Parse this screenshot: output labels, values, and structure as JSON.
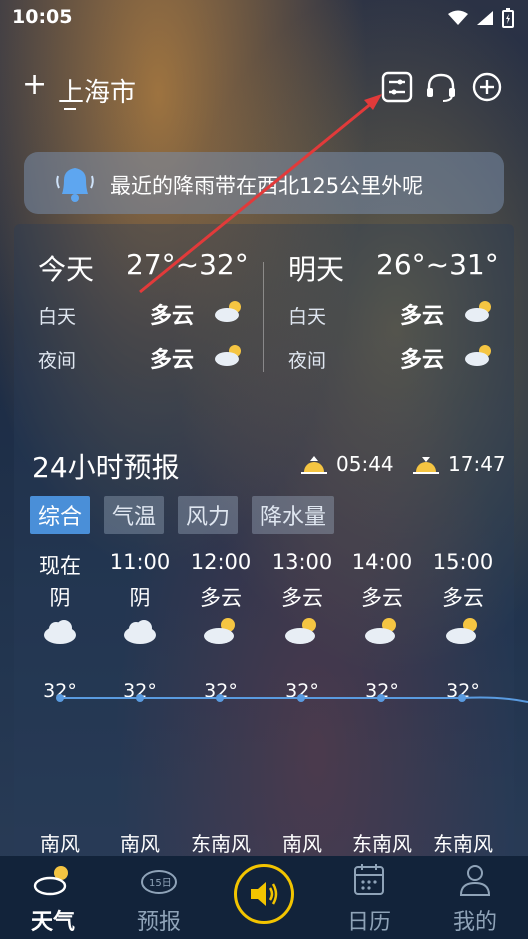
{
  "status": {
    "time": "10:05"
  },
  "header": {
    "add_label": "+",
    "city": "上海市"
  },
  "alert": {
    "text": "最近的降雨带在西北125公里外呢"
  },
  "days": [
    {
      "name": "今天",
      "range": "27°~32°",
      "day_label": "白天",
      "day_cond": "多云",
      "night_label": "夜间",
      "night_cond": "多云"
    },
    {
      "name": "明天",
      "range": "26°~31°",
      "day_label": "白天",
      "day_cond": "多云",
      "night_label": "夜间",
      "night_cond": "多云"
    }
  ],
  "forecast": {
    "title": "24小时预报",
    "sunrise": "05:44",
    "sunset": "17:47",
    "tabs": [
      "综合",
      "气温",
      "风力",
      "降水量"
    ],
    "hours": [
      {
        "time": "现在",
        "cond": "阴",
        "icon": "cloudy-icon",
        "temp": "32°",
        "wind": "南风"
      },
      {
        "time": "11:00",
        "cond": "阴",
        "icon": "cloudy-icon",
        "temp": "32°",
        "wind": "南风"
      },
      {
        "time": "12:00",
        "cond": "多云",
        "icon": "partly-cloudy-icon",
        "temp": "32°",
        "wind": "东南风"
      },
      {
        "time": "13:00",
        "cond": "多云",
        "icon": "partly-cloudy-icon",
        "temp": "32°",
        "wind": "南风"
      },
      {
        "time": "14:00",
        "cond": "多云",
        "icon": "partly-cloudy-icon",
        "temp": "32°",
        "wind": "东南风"
      },
      {
        "time": "15:00",
        "cond": "多云",
        "icon": "partly-cloudy-icon",
        "temp": "32°",
        "wind": "东南风"
      }
    ]
  },
  "nav": {
    "weather": "天气",
    "forecast": "预报",
    "calendar": "日历",
    "me": "我的",
    "forecast_badge": "15日"
  },
  "colors": {
    "accent": "#4a8fd8",
    "speaker_ring": "#f2c400",
    "arrow": "#e23a3a",
    "navbar": "#12233a"
  }
}
